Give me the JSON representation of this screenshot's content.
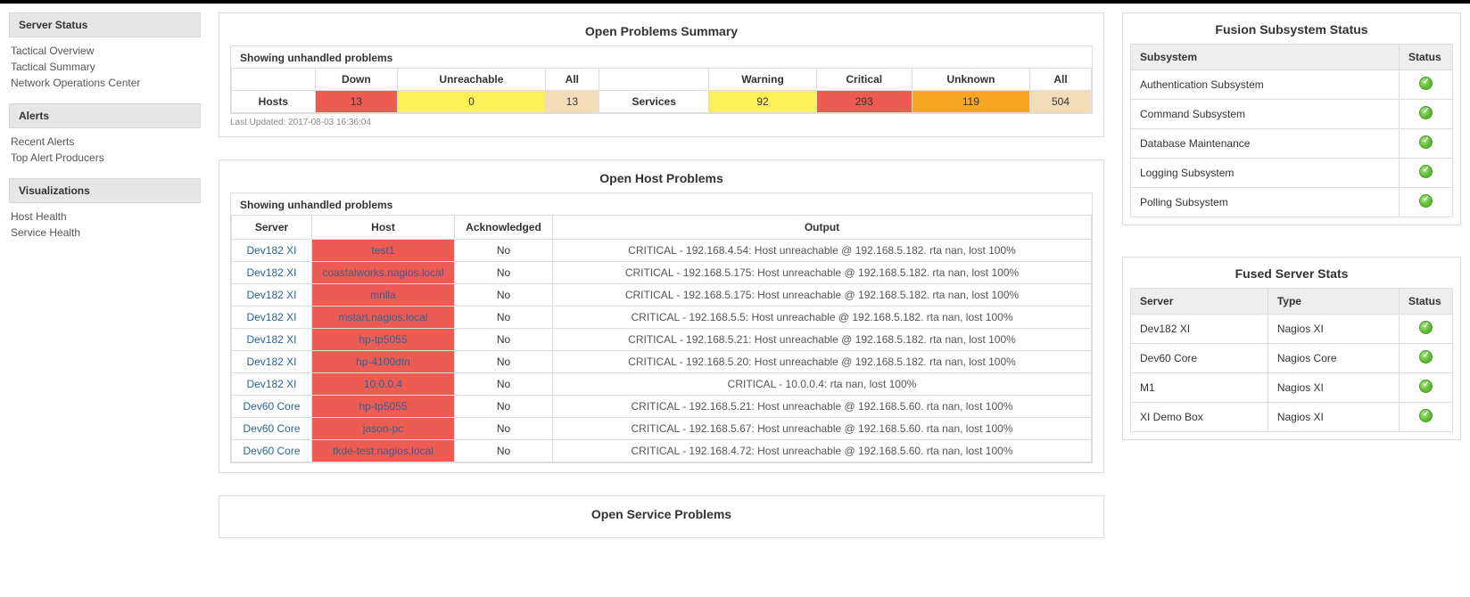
{
  "sidebar": {
    "groups": [
      {
        "header": "Server Status",
        "items": [
          "Tactical Overview",
          "Tactical Summary",
          "Network Operations Center"
        ]
      },
      {
        "header": "Alerts",
        "items": [
          "Recent Alerts",
          "Top Alert Producers"
        ]
      },
      {
        "header": "Visualizations",
        "items": [
          "Host Health",
          "Service Health"
        ]
      }
    ]
  },
  "summary": {
    "title": "Open Problems Summary",
    "showing": "Showing unhandled problems",
    "headers": {
      "down": "Down",
      "unreachable": "Unreachable",
      "all": "All",
      "warning": "Warning",
      "critical": "Critical",
      "unknown": "Unknown"
    },
    "row_labels": {
      "hosts": "Hosts",
      "services": "Services"
    },
    "hosts": {
      "down": "13",
      "unreachable": "0",
      "all": "13"
    },
    "services": {
      "warning": "92",
      "critical": "293",
      "unknown": "119",
      "all": "504"
    },
    "last_updated": "Last Updated: 2017-08-03 16:36:04"
  },
  "host_problems": {
    "title": "Open Host Problems",
    "showing": "Showing unhandled problems",
    "columns": {
      "server": "Server",
      "host": "Host",
      "ack": "Acknowledged",
      "output": "Output"
    },
    "rows": [
      {
        "server": "Dev182 XI",
        "host": "test1",
        "ack": "No",
        "output": "CRITICAL - 192.168.4.54: Host unreachable @ 192.168.5.182. rta nan, lost 100%"
      },
      {
        "server": "Dev182 XI",
        "host": "coastalworks.nagios.local",
        "ack": "No",
        "output": "CRITICAL - 192.168.5.175: Host unreachable @ 192.168.5.182. rta nan, lost 100%"
      },
      {
        "server": "Dev182 XI",
        "host": "mnlla",
        "ack": "No",
        "output": "CRITICAL - 192.168.5.175: Host unreachable @ 192.168.5.182. rta nan, lost 100%"
      },
      {
        "server": "Dev182 XI",
        "host": "mstart.nagios.local",
        "ack": "No",
        "output": "CRITICAL - 192.168.5.5: Host unreachable @ 192.168.5.182. rta nan, lost 100%"
      },
      {
        "server": "Dev182 XI",
        "host": "hp-tp5055",
        "ack": "No",
        "output": "CRITICAL - 192.168.5.21: Host unreachable @ 192.168.5.182. rta nan, lost 100%"
      },
      {
        "server": "Dev182 XI",
        "host": "hp-4100dtn",
        "ack": "No",
        "output": "CRITICAL - 192.168.5.20: Host unreachable @ 192.168.5.182. rta nan, lost 100%"
      },
      {
        "server": "Dev182 XI",
        "host": "10.0.0.4",
        "ack": "No",
        "output": "CRITICAL - 10.0.0.4: rta nan, lost 100%"
      },
      {
        "server": "Dev60 Core",
        "host": "hp-tp5055",
        "ack": "No",
        "output": "CRITICAL - 192.168.5.21: Host unreachable @ 192.168.5.60. rta nan, lost 100%"
      },
      {
        "server": "Dev60 Core",
        "host": "jason-pc",
        "ack": "No",
        "output": "CRITICAL - 192.168.5.67: Host unreachable @ 192.168.5.60. rta nan, lost 100%"
      },
      {
        "server": "Dev60 Core",
        "host": "tkde-test.nagios.local",
        "ack": "No",
        "output": "CRITICAL - 192.168.4.72: Host unreachable @ 192.168.5.60. rta nan, lost 100%"
      }
    ]
  },
  "service_problems": {
    "title": "Open Service Problems"
  },
  "fusion": {
    "title": "Fusion Subsystem Status",
    "columns": {
      "subsystem": "Subsystem",
      "status": "Status"
    },
    "rows": [
      {
        "name": "Authentication Subsystem"
      },
      {
        "name": "Command Subsystem"
      },
      {
        "name": "Database Maintenance"
      },
      {
        "name": "Logging Subsystem"
      },
      {
        "name": "Polling Subsystem"
      }
    ]
  },
  "server_stats": {
    "title": "Fused Server Stats",
    "columns": {
      "server": "Server",
      "type": "Type",
      "status": "Status"
    },
    "rows": [
      {
        "server": "Dev182 XI",
        "type": "Nagios XI"
      },
      {
        "server": "Dev60 Core",
        "type": "Nagios Core"
      },
      {
        "server": "M1",
        "type": "Nagios XI"
      },
      {
        "server": "XI Demo Box",
        "type": "Nagios XI"
      }
    ]
  }
}
